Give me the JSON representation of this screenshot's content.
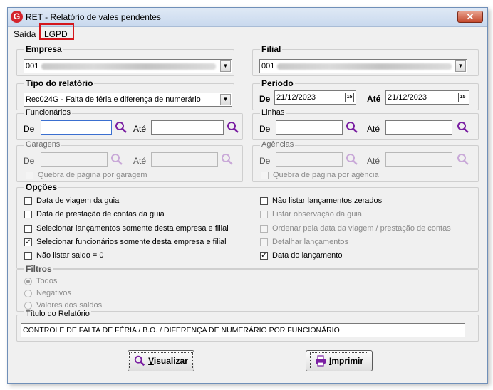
{
  "window": {
    "title": "RET - Relatório de vales pendentes",
    "icon": "G",
    "close": "✕"
  },
  "menu": {
    "saida": "Saída",
    "lgpd": "LGPD"
  },
  "empresa": {
    "label": "Empresa",
    "code": "001"
  },
  "filial": {
    "label": "Filial",
    "code": "001"
  },
  "tipo": {
    "label": "Tipo do relatório",
    "value": "Rec024G - Falta de féria e diferença de numerário"
  },
  "periodo": {
    "label": "Período",
    "de": "De",
    "de_value": "21/12/2023",
    "ate": "Até",
    "ate_value": "21/12/2023",
    "cal": "15"
  },
  "funcionarios": {
    "label": "Funcionários",
    "de": "De",
    "ate": "Até"
  },
  "linhas": {
    "label": "Linhas",
    "de": "De",
    "ate": "Até"
  },
  "garagens": {
    "label": "Garagens",
    "de": "De",
    "ate": "Até",
    "quebra": "Quebra de página por garagem"
  },
  "agencias": {
    "label": "Agências",
    "de": "De",
    "ate": "Até",
    "quebra": "Quebra de página por agência"
  },
  "opcoes": {
    "label": "Opções",
    "left": [
      {
        "text": "Data de viagem da guia",
        "checked": false
      },
      {
        "text": "Data de prestação de contas da guia",
        "checked": false
      },
      {
        "text": "Selecionar lançamentos somente desta empresa e filial",
        "checked": false
      },
      {
        "text": "Selecionar funcionários somente desta empresa e filial",
        "checked": true
      },
      {
        "text": "Não listar saldo = 0",
        "checked": false
      }
    ],
    "right": [
      {
        "text": "Não listar lançamentos zerados",
        "checked": false
      },
      {
        "text": "Listar observação da guia",
        "checked": false
      },
      {
        "text": "Ordenar pela data da viagem / prestação de contas",
        "checked": false
      },
      {
        "text": "Detalhar lançamentos",
        "checked": false
      },
      {
        "text": "Data do lançamento",
        "checked": true
      }
    ]
  },
  "filtros": {
    "label": "Filtros",
    "todos": "Todos",
    "negativos": "Negativos",
    "valores": "Valores dos saldos"
  },
  "titulo": {
    "label": "Título do Relatório",
    "value": "CONTROLE DE FALTA DE FÉRIA / B.O. / DIFERENÇA DE NUMERÁRIO POR FUNCIONÁRIO"
  },
  "buttons": {
    "visualizar_u": "V",
    "visualizar_rest": "isualizar",
    "imprimir_u": "I",
    "imprimir_rest": "mprimir"
  },
  "colors": {
    "accent": "#7a1fa2",
    "highlight": "#d4161c"
  }
}
